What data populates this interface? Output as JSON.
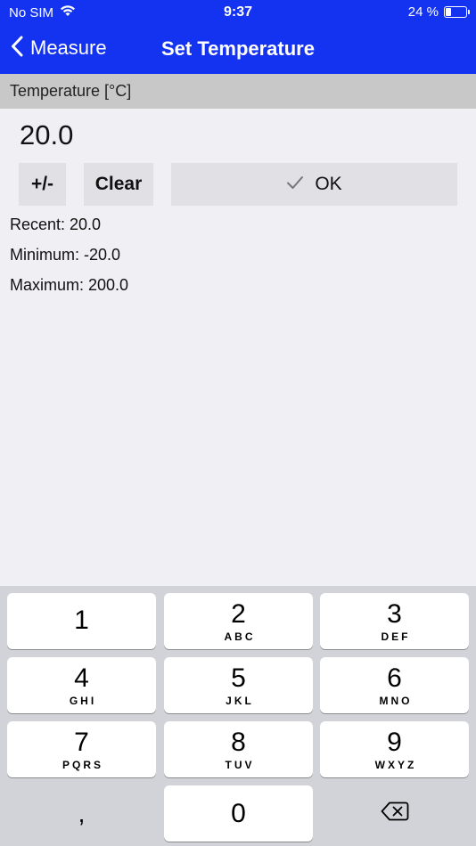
{
  "status": {
    "carrier": "No SIM",
    "time": "9:37",
    "battery_percent": "24 %",
    "battery_level": 0.24
  },
  "nav": {
    "back_label": "Measure",
    "title": "Set Temperature"
  },
  "section": {
    "header": "Temperature [°C]"
  },
  "entry": {
    "value": "20.0"
  },
  "buttons": {
    "sign": "+/-",
    "clear": "Clear",
    "ok": "OK"
  },
  "info": {
    "recent": "Recent: 20.0",
    "minimum": "Minimum: -20.0",
    "maximum": "Maximum: 200.0"
  },
  "keypad": {
    "keys": [
      {
        "digit": "1",
        "letters": ""
      },
      {
        "digit": "2",
        "letters": "ABC"
      },
      {
        "digit": "3",
        "letters": "DEF"
      },
      {
        "digit": "4",
        "letters": "GHI"
      },
      {
        "digit": "5",
        "letters": "JKL"
      },
      {
        "digit": "6",
        "letters": "MNO"
      },
      {
        "digit": "7",
        "letters": "PQRS"
      },
      {
        "digit": "8",
        "letters": "TUV"
      },
      {
        "digit": "9",
        "letters": "WXYZ"
      }
    ],
    "comma": ",",
    "zero": "0",
    "delete_icon": "backspace-icon"
  },
  "colors": {
    "nav_background": "#1433f0",
    "section_header": "#c8c8c8",
    "button_background": "#e0e0e5",
    "page_background": "#efeff4",
    "keyboard_background": "#d1d3d9"
  }
}
